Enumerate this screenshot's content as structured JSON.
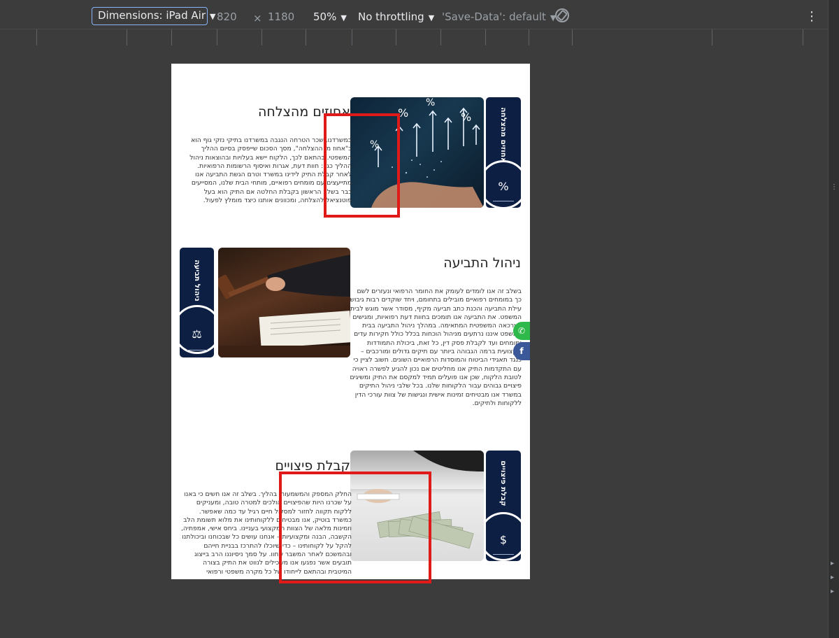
{
  "toolbar": {
    "dimensions_label": "Dimensions: iPad Air",
    "width_value": "820",
    "separator": "×",
    "height_value": "1180",
    "zoom_label": "50%",
    "throttling_label": "No throttling",
    "save_data_label": "'Save-Data': default"
  },
  "sections": [
    {
      "title": "אחוזים מהצלחה",
      "side_label": "אחוזים מהצלחה",
      "text": "במשרדנו, שכר הטרחה הנגבה במשרדנו בתיקי נזקי גוף הוא כ\"אחוז מן ההצלחה\", מסך הסכום שייפסק בסיום ההליך המשפטי. בהתאם לכך, הלקוח יישא בעלויות ובהוצאות ניהול ההליך כגון: חוות דעת, אגרות ואיסוף הרשומות הרפואיות. לאחר קבלת התיק לידינו במשרד וטרם הגשת התביעה אנו מתייעצים עם מומחים רפואיים, מותחי הבית שלנו, המסייעים כבר בשלב הראשון בקבלת החלטה אם התיק הוא בעל פוטנציאל להצלחה, ומכוונים אותנו כיצד מומלץ לפעול."
    },
    {
      "title": "ניהול התביעה",
      "side_label": "ניהול תביעה",
      "text": "בשלב זה אנו לומדים לעומק את החומר הרפואי ונעזרים לשם כך במומחים רפואיים מובילים בתחומם, ויחד שוקדים רבות גיבוש עילת התביעה והכנת כתב תביעה מקיף, מסודר אשר מוגש לבית המשפט. את התביעה אנו תומכים בחוות דעת רפואיות, ומגישים לערכאה המשפטית המתאימה. במהלך ניהול התביעה בבית המשפט איננו נרתעים מניהול הוכחות בכלל כולל חקירות עדים ומומחים ועד לקבלת פסק דין, כל זאת, ביכולת התמודדות מקצועית ברמה הגבוהה ביותר עם תיקים גדולים ומורכבים – כנגד תאגידי הביטוח והמוסדות הרפואיים השונים. חשוב לציין כי עם התקדמות התיק אנו מחליטים אם נכון להגיע לפשרה ראויה לטובת הלקוח, שכן אנו פועלים תמיד למקסם את התיק ומשיגים פיצויים גבוהים עבור הלקוחות שלנו. בכל שלבי ניהול התיקים במשרד אנו מבטיחים זמינות אישית ונגישות של צוות עורכי הדין ללקוחות ולתיקים."
    },
    {
      "title": "קבלת פיצויים",
      "side_label": "קבלת פיצויים",
      "text": "החלק המספק והמשמעותי בהליך. בשלב זה אנו חשים כי באנו על שכרנו היות שהפיצויים הולכים למטרה טובה, ומעניקים ללקוח תקווה לחזור למסלול חיים רגיל עד כמה שאפשר. כמשרד בוטיק, אנו מבטיחים ללקוחותינו את מלוא תשומת הלב וזמינות מלאה של הצוות המקצועי בעניינו. ביחס אישי, אמפתיה, הקשבה, הבנה ומקצועיות – אנחנו עושים כל שבכוחנו וביכולתנו להקל על לקוחותינו – כדי שיוכלו להתרכז בבניית חייהם ובהמשכם לאחר המשבר שחוו. על סמך ניסיוננו הרב בייצוג תובעים אשר נפגעו אנו משכילים לנווט את התיק בצורה המיטבית ובהתאם לייחודו של כל מקרה משפטי ורפואי"
    }
  ],
  "floating_buttons": {
    "whatsapp_icon": "whatsapp-icon",
    "facebook_label": "f"
  },
  "colors": {
    "navy": "#0e1f44",
    "whatsapp": "#2fb94a",
    "facebook": "#3b5998",
    "highlight": "#e01919",
    "devtools_bg": "#3c3c3c"
  }
}
